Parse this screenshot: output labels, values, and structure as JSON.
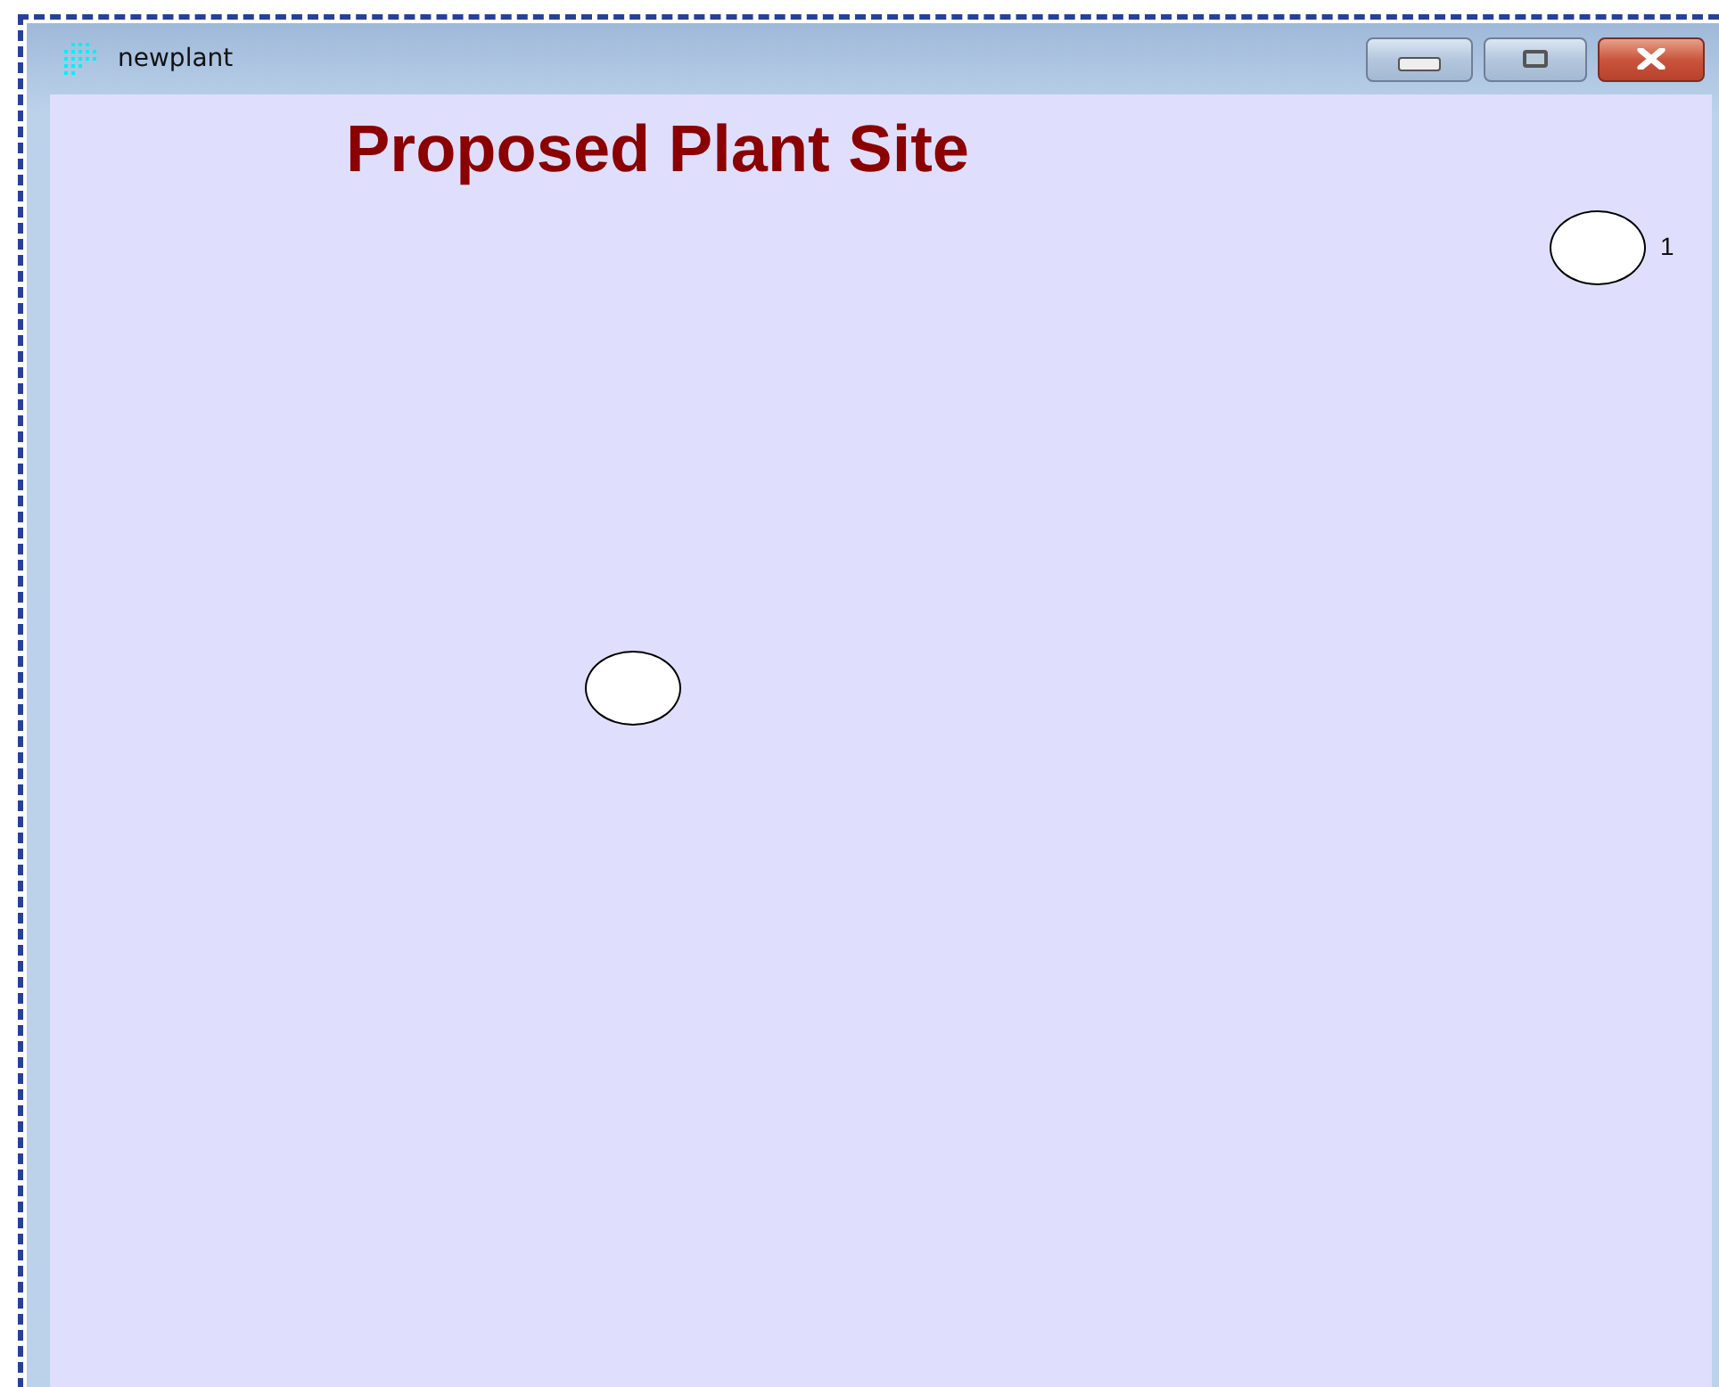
{
  "window": {
    "title": "newplant"
  },
  "heading": "Proposed Plant Site",
  "points": [
    {
      "kind": "labeled",
      "label": "1"
    },
    {
      "kind": "plain"
    }
  ]
}
